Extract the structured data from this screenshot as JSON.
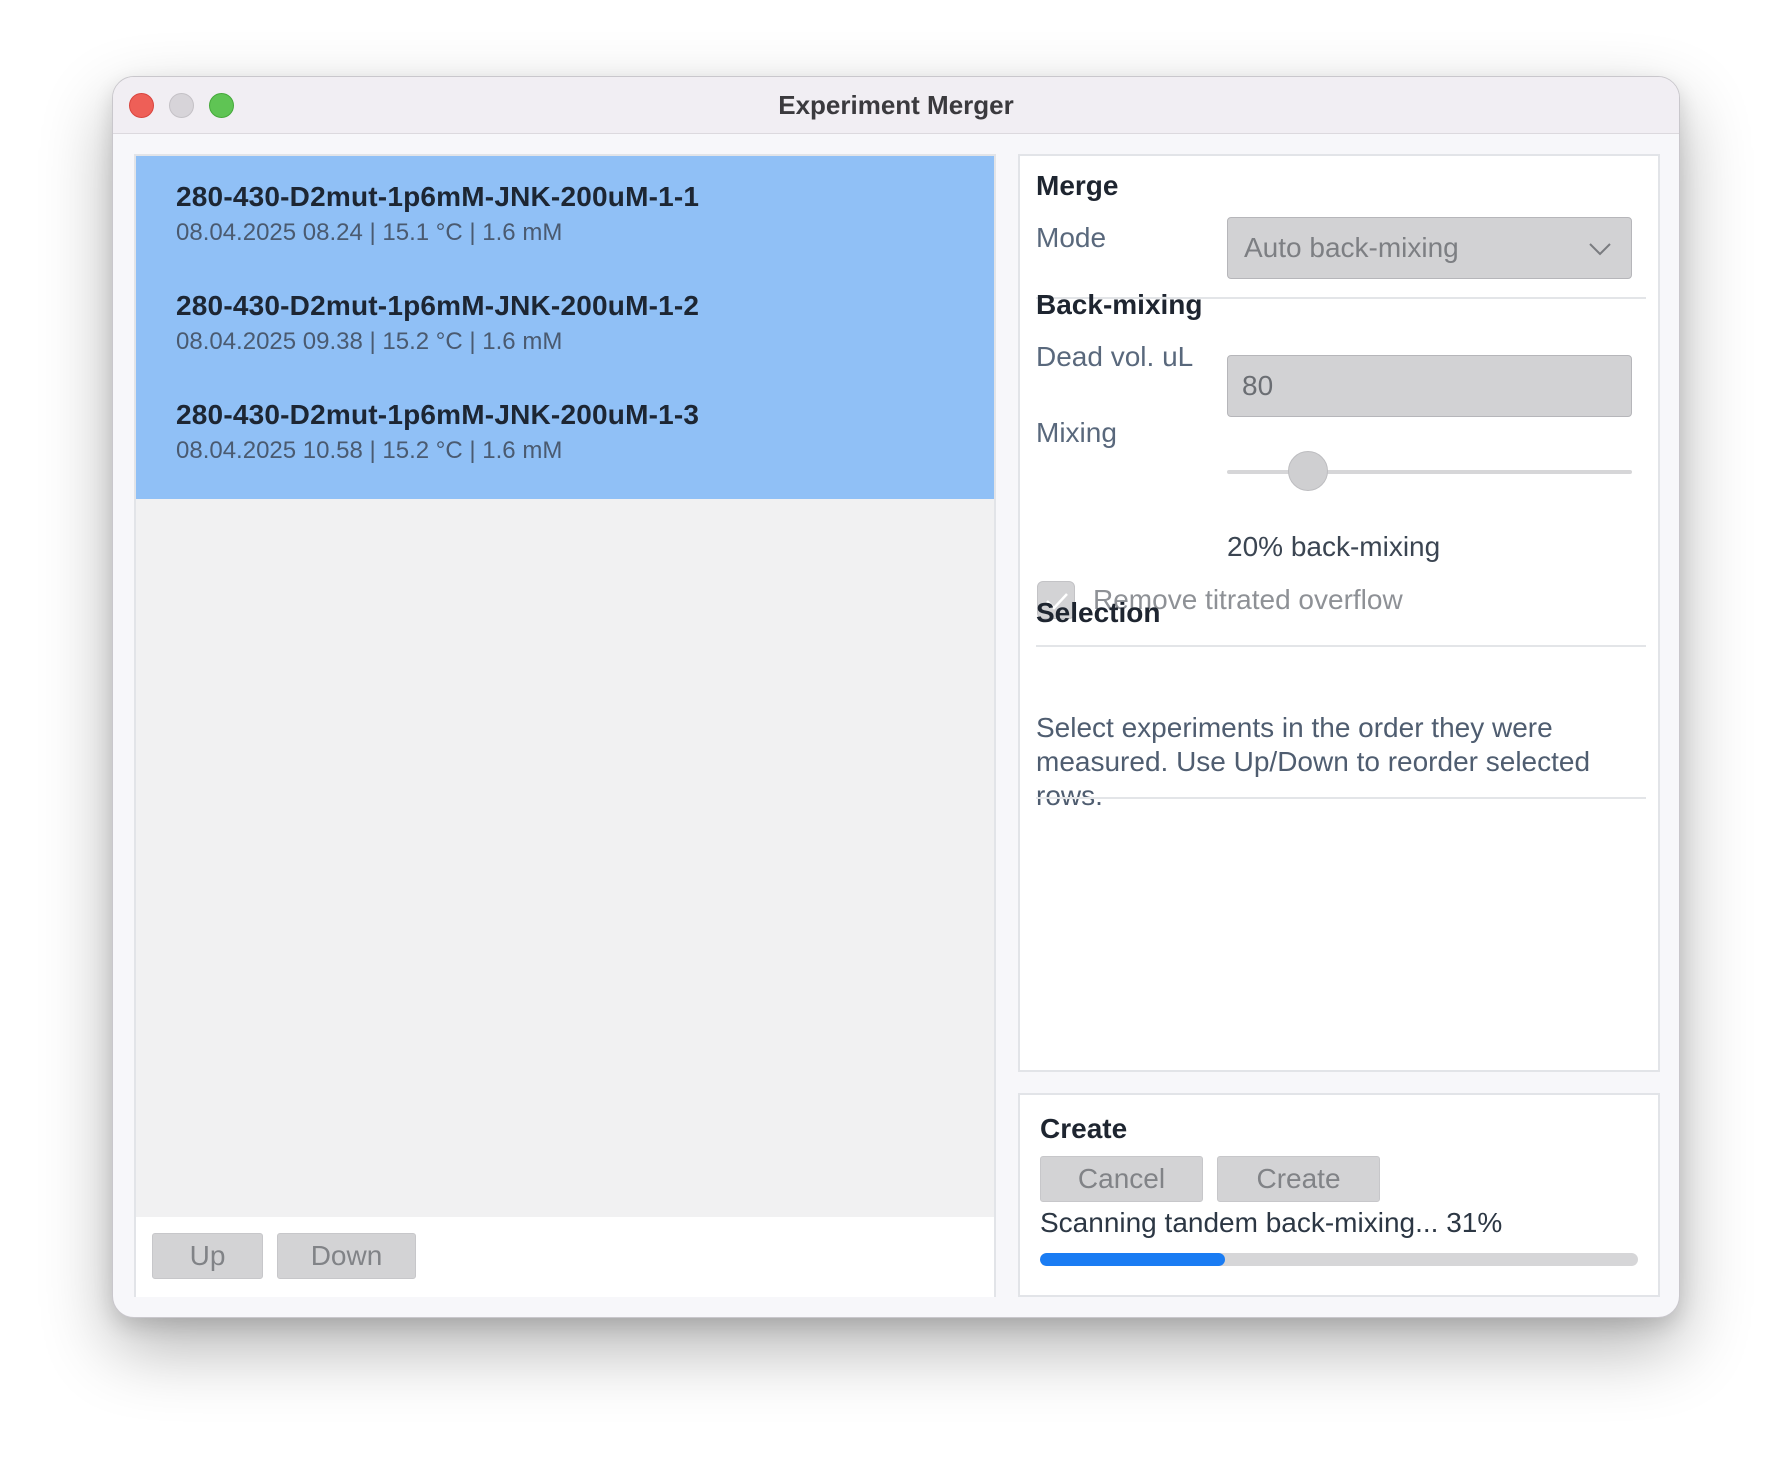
{
  "window": {
    "title": "Experiment Merger"
  },
  "experiments": [
    {
      "name": "280-430-D2mut-1p6mM-JNK-200uM-1-1",
      "meta": "08.04.2025 08.24 | 15.1 °C | 1.6 mM",
      "selected": true
    },
    {
      "name": "280-430-D2mut-1p6mM-JNK-200uM-1-2",
      "meta": "08.04.2025 09.38 | 15.2 °C | 1.6 mM",
      "selected": true
    },
    {
      "name": "280-430-D2mut-1p6mM-JNK-200uM-1-3",
      "meta": "08.04.2025 10.58 | 15.2 °C | 1.6 mM",
      "selected": true
    }
  ],
  "list_buttons": {
    "up": "Up",
    "down": "Down"
  },
  "merge": {
    "heading": "Merge",
    "mode_label": "Mode",
    "mode_value": "Auto back-mixing"
  },
  "back_mixing": {
    "heading": "Back-mixing",
    "dead_vol_label": "Dead vol. uL",
    "dead_vol_value": "80",
    "mixing_label": "Mixing",
    "mixing_fraction": 0.2,
    "mixing_caption": "20% back-mixing",
    "remove_overflow_label": "Remove titrated overflow",
    "remove_overflow_checked": true
  },
  "selection": {
    "heading": "Selection",
    "description": "Select experiments in the order they were measured. Use Up/Down to reorder selected rows."
  },
  "create": {
    "heading": "Create",
    "cancel_label": "Cancel",
    "create_label": "Create",
    "status": "Scanning tandem back-mixing... 31%",
    "progress": 0.31
  },
  "colors": {
    "selection_row": "#90c0f6",
    "progress_fill": "#1a7cf3",
    "close": "#ee5f57",
    "maximize": "#5fc454"
  },
  "icons": {
    "dropdown": "chevron-down-icon",
    "checkbox": "checkmark-icon"
  }
}
